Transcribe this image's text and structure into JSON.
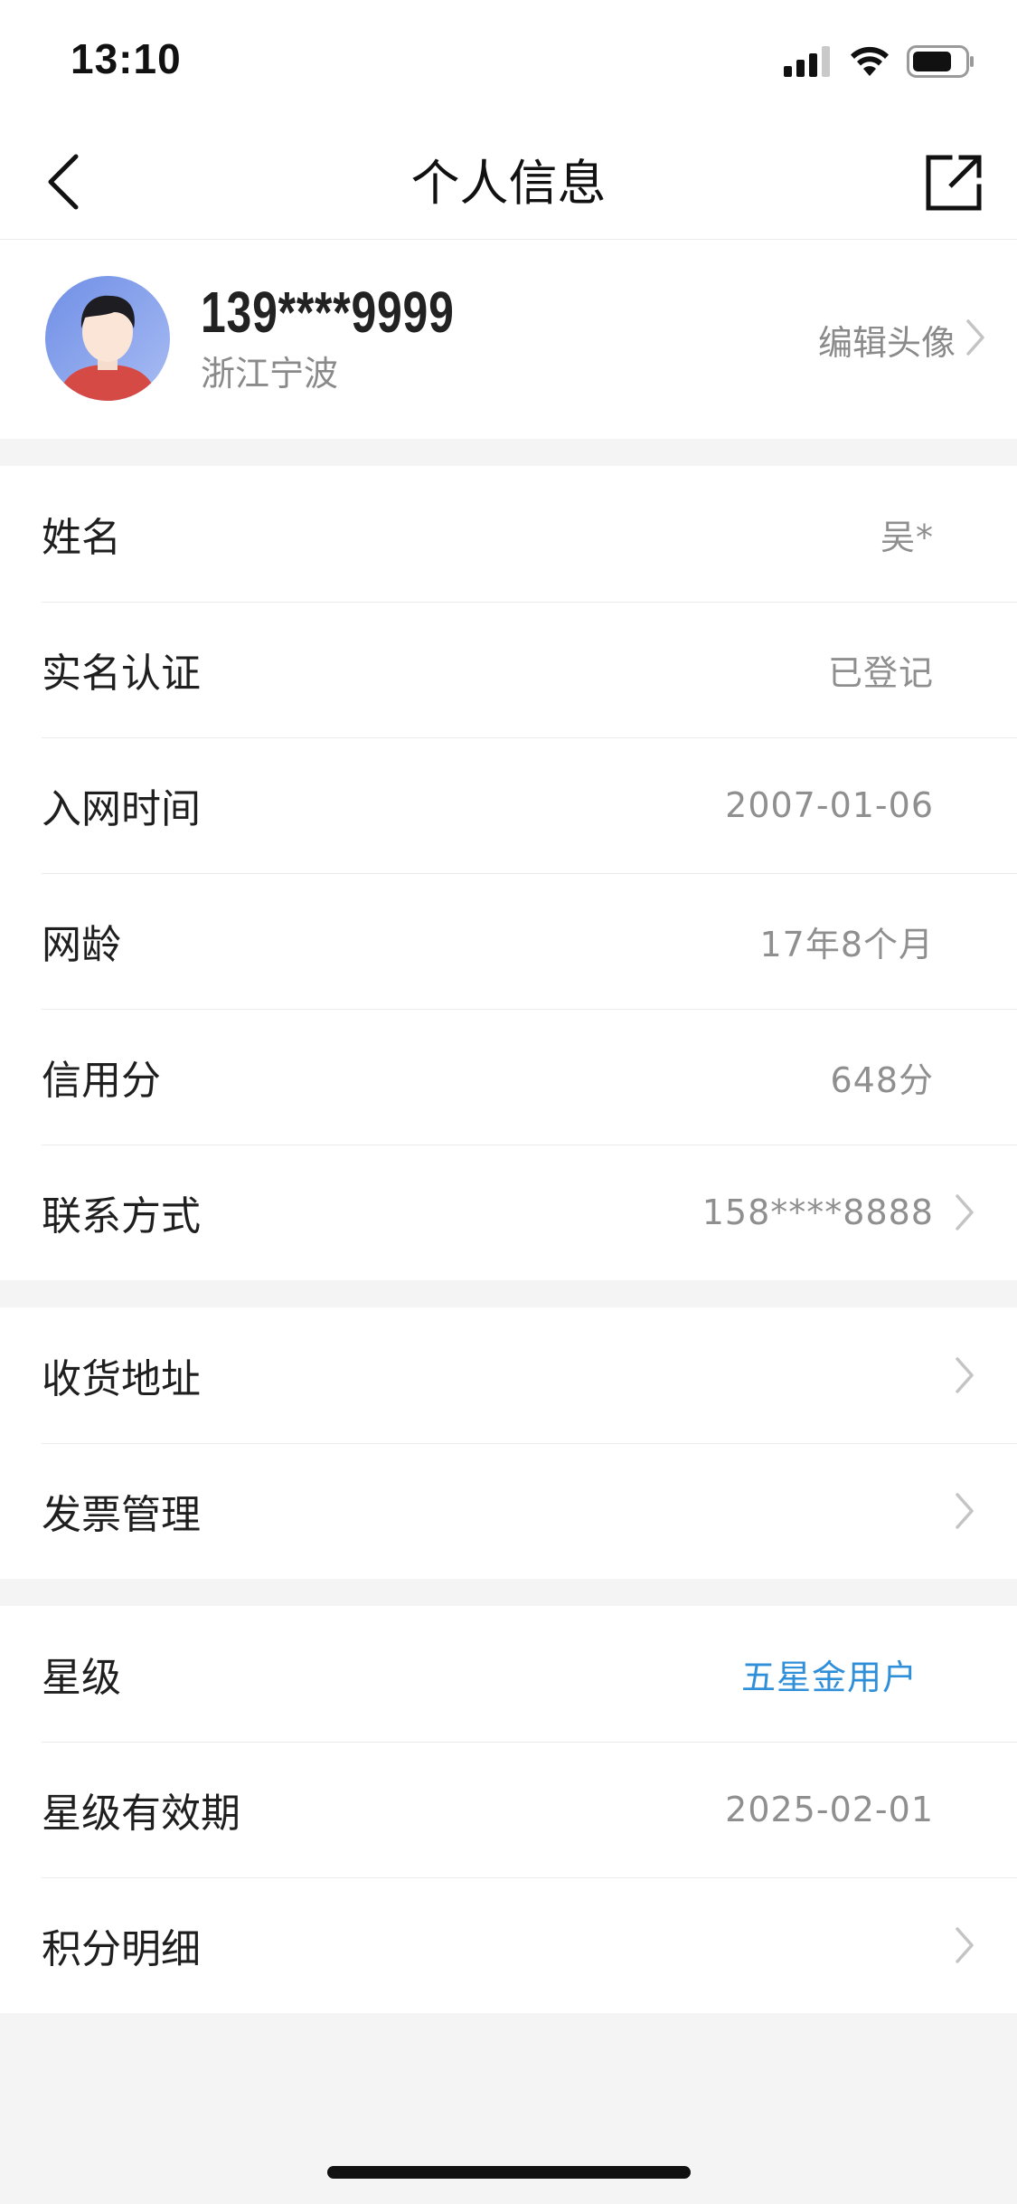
{
  "status_bar": {
    "time": "13:10",
    "icons": [
      "cellular-signal-icon",
      "wifi-icon",
      "battery-icon"
    ]
  },
  "nav": {
    "title": "个人信息",
    "back_icon": "chevron-left-icon",
    "share_icon": "share-external-icon"
  },
  "profile": {
    "phone": "139****9999",
    "location": "浙江宁波",
    "edit_label": "编辑头像"
  },
  "groups": [
    {
      "rows": [
        {
          "label": "姓名",
          "value": "吴*"
        },
        {
          "label": "实名认证",
          "value": "已登记"
        },
        {
          "label": "入网时间",
          "value": "2007-01-06"
        },
        {
          "label": "网龄",
          "value": "17年8个月"
        },
        {
          "label": "信用分",
          "value": "648分"
        },
        {
          "label": "联系方式",
          "value": "158****8888"
        }
      ]
    },
    {
      "rows": [
        {
          "label": "收货地址"
        },
        {
          "label": "发票管理"
        }
      ]
    },
    {
      "rows": [
        {
          "label": "星级",
          "value": "五星金用户"
        },
        {
          "label": "星级有效期",
          "value": "2025-02-01"
        },
        {
          "label": "积分明细"
        }
      ]
    }
  ],
  "colors": {
    "accent": "#2f8fd8",
    "page_background": "#f4f4f5",
    "secondary_text": "#8f8f8f"
  }
}
